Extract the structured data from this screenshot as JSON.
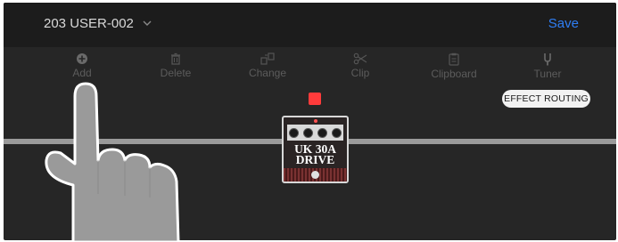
{
  "header": {
    "preset_name": "203 USER-002",
    "save_label": "Save"
  },
  "toolbar": {
    "items": [
      {
        "label": "Add",
        "icon": "add-icon"
      },
      {
        "label": "Delete",
        "icon": "trash-icon"
      },
      {
        "label": "Change",
        "icon": "change-icon"
      },
      {
        "label": "Clip",
        "icon": "scissors-icon"
      },
      {
        "label": "Clipboard",
        "icon": "clipboard-icon"
      },
      {
        "label": "Tuner",
        "icon": "tuner-fork-icon"
      }
    ]
  },
  "routing": {
    "label": "EFFECT ROUTING"
  },
  "pedal": {
    "name_line1": "UK 30A",
    "name_line2": "DRIVE",
    "enabled": true,
    "knob_count": 4
  },
  "colors": {
    "accent": "#2f7ff5",
    "background": "#262626",
    "header": "#1c1c1c",
    "signal_line": "#9a9a9a",
    "effect_on": "#ff3b3b"
  }
}
